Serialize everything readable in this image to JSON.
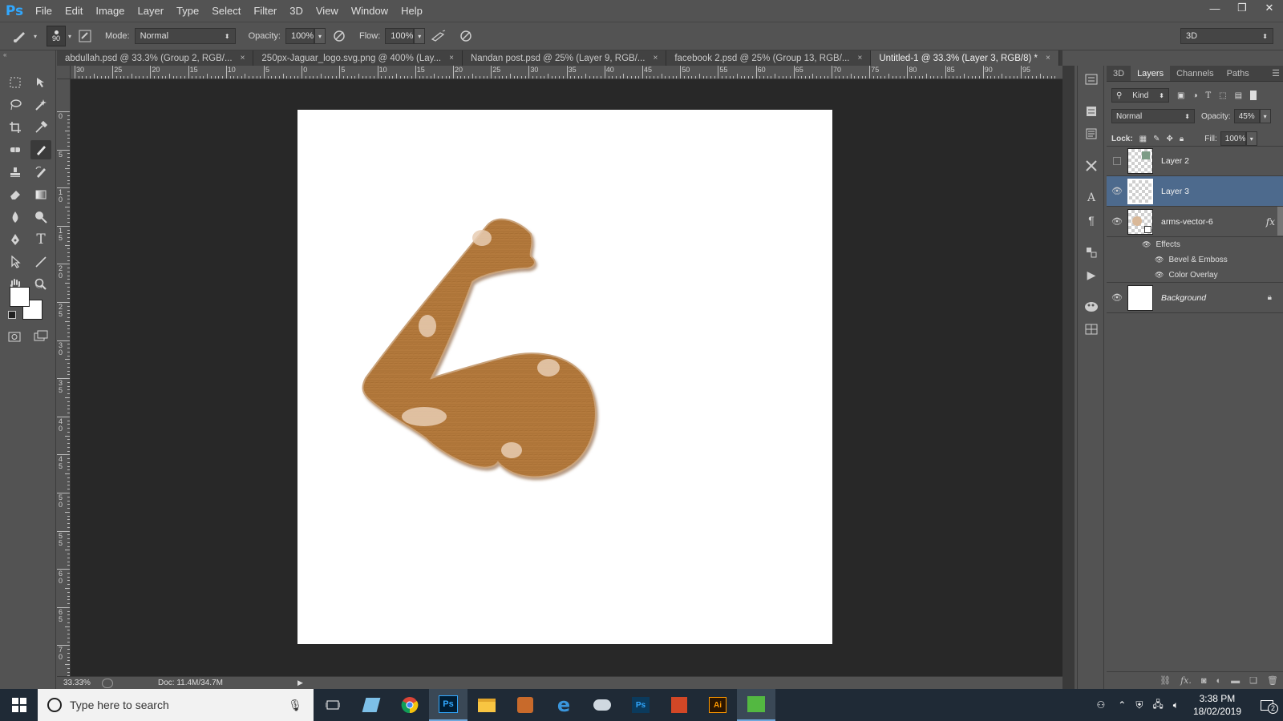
{
  "app": {
    "logo": "Ps"
  },
  "menu": [
    "File",
    "Edit",
    "Image",
    "Layer",
    "Type",
    "Select",
    "Filter",
    "3D",
    "View",
    "Window",
    "Help"
  ],
  "window_controls": {
    "minimize": "—",
    "restore": "❐",
    "close": "✕"
  },
  "options": {
    "brush_size": "90",
    "mode_label": "Mode:",
    "mode_value": "Normal",
    "opacity_label": "Opacity:",
    "opacity_value": "100%",
    "flow_label": "Flow:",
    "flow_value": "100%",
    "workspace": "3D"
  },
  "tabs": [
    {
      "label": "abdullah.psd @ 33.3% (Group 2, RGB/...",
      "close": "×"
    },
    {
      "label": "250px-Jaguar_logo.svg.png @ 400% (Lay...",
      "close": "×"
    },
    {
      "label": "Nandan post.psd @ 25% (Layer 9, RGB/...",
      "close": "×"
    },
    {
      "label": "facebook 2.psd @ 25% (Group 13, RGB/...",
      "close": "×"
    },
    {
      "label": "Untitled-1 @ 33.3% (Layer 3, RGB/8) *",
      "close": "×"
    }
  ],
  "hruler_ticks": [
    "30",
    "25",
    "20",
    "15",
    "10",
    "5",
    "0",
    "5",
    "10",
    "15",
    "20",
    "25",
    "30",
    "35",
    "40",
    "45",
    "50",
    "55",
    "60",
    "65",
    "70",
    "75",
    "80",
    "85",
    "90",
    "95"
  ],
  "vruler_ticks": [
    "0",
    "5",
    "1 0",
    "1 5",
    "2 0",
    "2 5",
    "3 0",
    "3 5",
    "4 0",
    "4 5",
    "5 0",
    "5 5",
    "6 0",
    "6 5",
    "7 0"
  ],
  "status": {
    "zoom": "33.33%",
    "doc": "Doc: 11.4M/34.7M"
  },
  "panel": {
    "tabs": [
      "3D",
      "Layers",
      "Channels",
      "Paths"
    ],
    "active_tab": "Layers",
    "kind": "Kind",
    "blend_mode": "Normal",
    "opacity_label": "Opacity:",
    "opacity_value": "45%",
    "lock_label": "Lock:",
    "fill_label": "Fill:",
    "fill_value": "100%",
    "layers": [
      {
        "name": "Layer 2",
        "visible": false,
        "selected": false
      },
      {
        "name": "Layer 3",
        "visible": true,
        "selected": true
      },
      {
        "name": "arms-vector-6",
        "visible": true,
        "selected": false,
        "fx": "fx"
      },
      {
        "name": "Background",
        "visible": true,
        "selected": false,
        "locked": true
      }
    ],
    "effects_label": "Effects",
    "effects": [
      "Bevel & Emboss",
      "Color Overlay"
    ]
  },
  "taskbar": {
    "search_placeholder": "Type here to search",
    "time": "3:38 PM",
    "date": "18/02/2019",
    "notifications": "2",
    "ps_label": "Ps",
    "ai_label": "Ai"
  },
  "colors": {
    "accent": "#31a8ff",
    "selection": "#4d6a8d",
    "arm": "#b47a3d"
  }
}
